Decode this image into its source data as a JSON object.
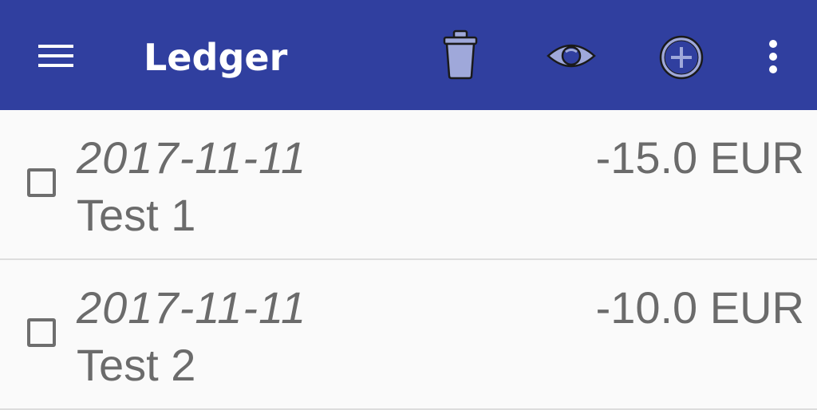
{
  "appbar": {
    "title": "Ledger",
    "icons": {
      "menu": "hamburger-menu-icon",
      "delete": "trash-icon",
      "view": "eye-icon",
      "add": "add-circle-icon",
      "more": "more-vert-icon"
    },
    "colors": {
      "background": "#303f9f",
      "title": "#ffffff",
      "icon_fill": "#9fa8da"
    }
  },
  "entries": [
    {
      "date": "2017-11-11",
      "description": "Test 1",
      "amount": "-15.0 EUR",
      "checked": false
    },
    {
      "date": "2017-11-11",
      "description": "Test 2",
      "amount": "-10.0 EUR",
      "checked": false
    }
  ],
  "colors": {
    "list_background": "#fafafa",
    "text": "#6b6b6b",
    "divider": "#dddddd"
  }
}
